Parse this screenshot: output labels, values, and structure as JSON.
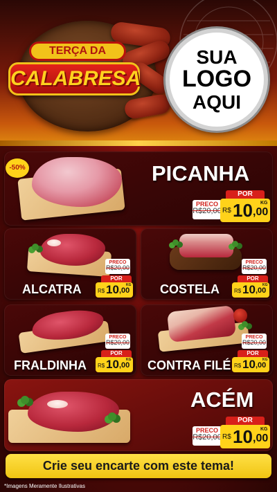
{
  "header": {
    "title_top": "TERÇA DA",
    "title_main": "CALABRESA",
    "logo_lines": [
      "SUA",
      "LOGO",
      "AQUI"
    ]
  },
  "products": [
    {
      "id": "picanha",
      "name": "PICANHA",
      "preco_label": "PRECO",
      "old_price": "R$20,00",
      "por_label": "POR",
      "currency": "R$",
      "price_int": "10",
      "price_dec": ",00",
      "unit": "KG",
      "discount": "-50%"
    },
    {
      "id": "alcatra",
      "name": "ALCATRA",
      "preco_label": "PRECO",
      "old_price": "R$20,00",
      "por_label": "POR",
      "currency": "R$",
      "price_int": "10",
      "price_dec": ",00",
      "unit": "KG"
    },
    {
      "id": "costela",
      "name": "COSTELA",
      "preco_label": "PRECO",
      "old_price": "R$20,00",
      "por_label": "POR",
      "currency": "R$",
      "price_int": "10",
      "price_dec": ",00",
      "unit": "KG"
    },
    {
      "id": "fraldinha",
      "name": "FRALDINHA",
      "preco_label": "PRECO",
      "old_price": "R$20,00",
      "por_label": "POR",
      "currency": "R$",
      "price_int": "10",
      "price_dec": ",00",
      "unit": "KG"
    },
    {
      "id": "contrafile",
      "name": "CONTRA FILÉ",
      "preco_label": "PRECO",
      "old_price": "R$20,00",
      "por_label": "POR",
      "currency": "R$",
      "price_int": "10",
      "price_dec": ",00",
      "unit": "KG"
    },
    {
      "id": "acem",
      "name": "ACÉM",
      "preco_label": "PRECO",
      "old_price": "R$20,00",
      "por_label": "POR",
      "currency": "R$",
      "price_int": "10",
      "price_dec": ",00",
      "unit": "KG"
    }
  ],
  "footer": {
    "cta": "Crie seu encarte com este tema!",
    "disclaimer": "*Imagens Meramente Ilustrativas"
  },
  "colors": {
    "background_red": "#8e1410",
    "accent_yellow": "#ffd21a",
    "price_red": "#d8201a"
  }
}
